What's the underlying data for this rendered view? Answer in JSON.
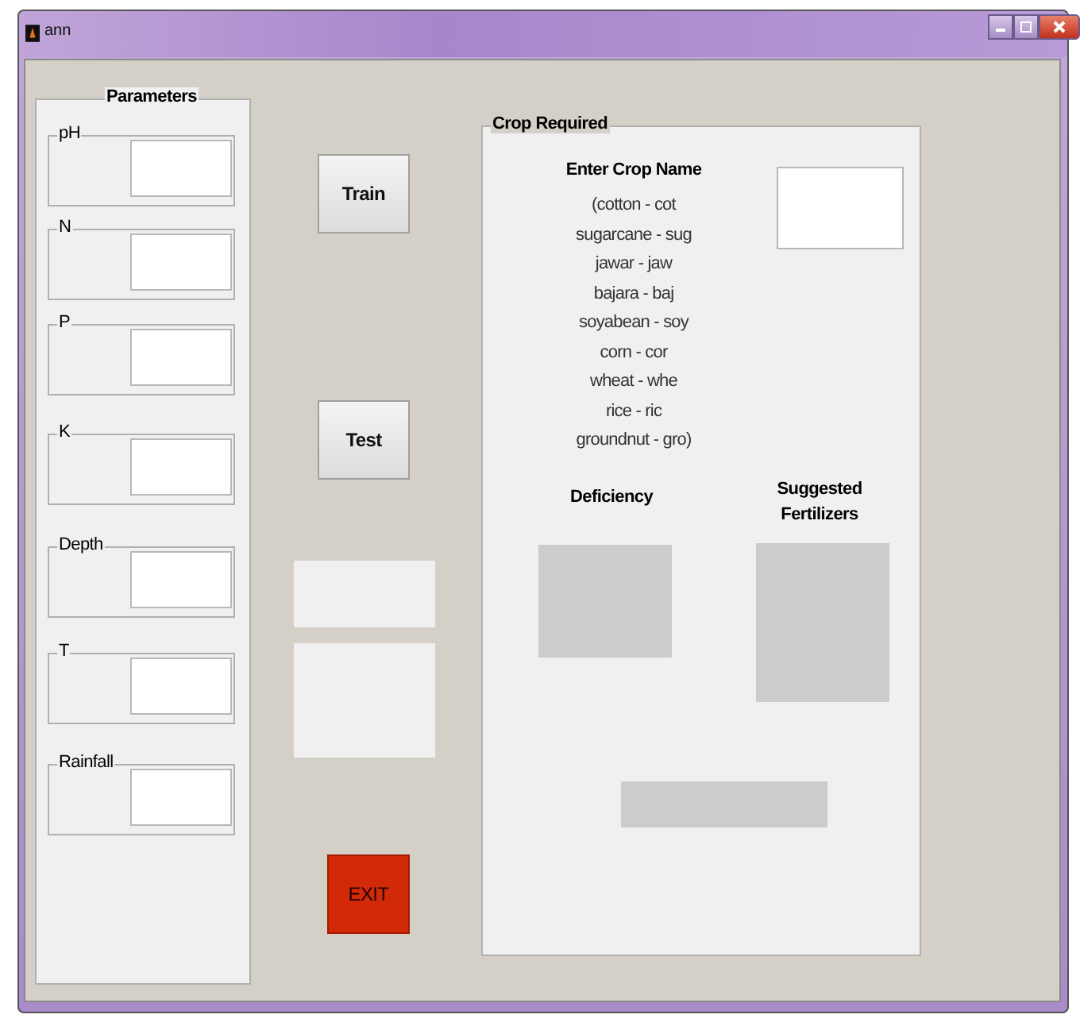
{
  "window": {
    "title": "ann"
  },
  "parameters": {
    "title": "Parameters",
    "fields": [
      {
        "label": "pH"
      },
      {
        "label": "N"
      },
      {
        "label": "P"
      },
      {
        "label": "K"
      },
      {
        "label": "Depth"
      },
      {
        "label": "T"
      },
      {
        "label": "Rainfall"
      }
    ]
  },
  "buttons": [
    {
      "label": "Train",
      "kind": "normal"
    },
    {
      "label": "Test",
      "kind": "normal"
    },
    {
      "label": "EXIT",
      "kind": "danger"
    }
  ],
  "crop": {
    "title": "Crop Required",
    "prompt": "Enter Crop Name",
    "codes": [
      "(cotton - cot",
      "sugarcane - sug",
      "jawar - jaw",
      "bajara - baj",
      "soyabean - soy",
      "corn - cor",
      "wheat - whe",
      "rice - ric",
      "groundnut - gro)"
    ],
    "deficiency_label": "Deficiency",
    "fertilizers_label": "Suggested Fertilizers"
  }
}
